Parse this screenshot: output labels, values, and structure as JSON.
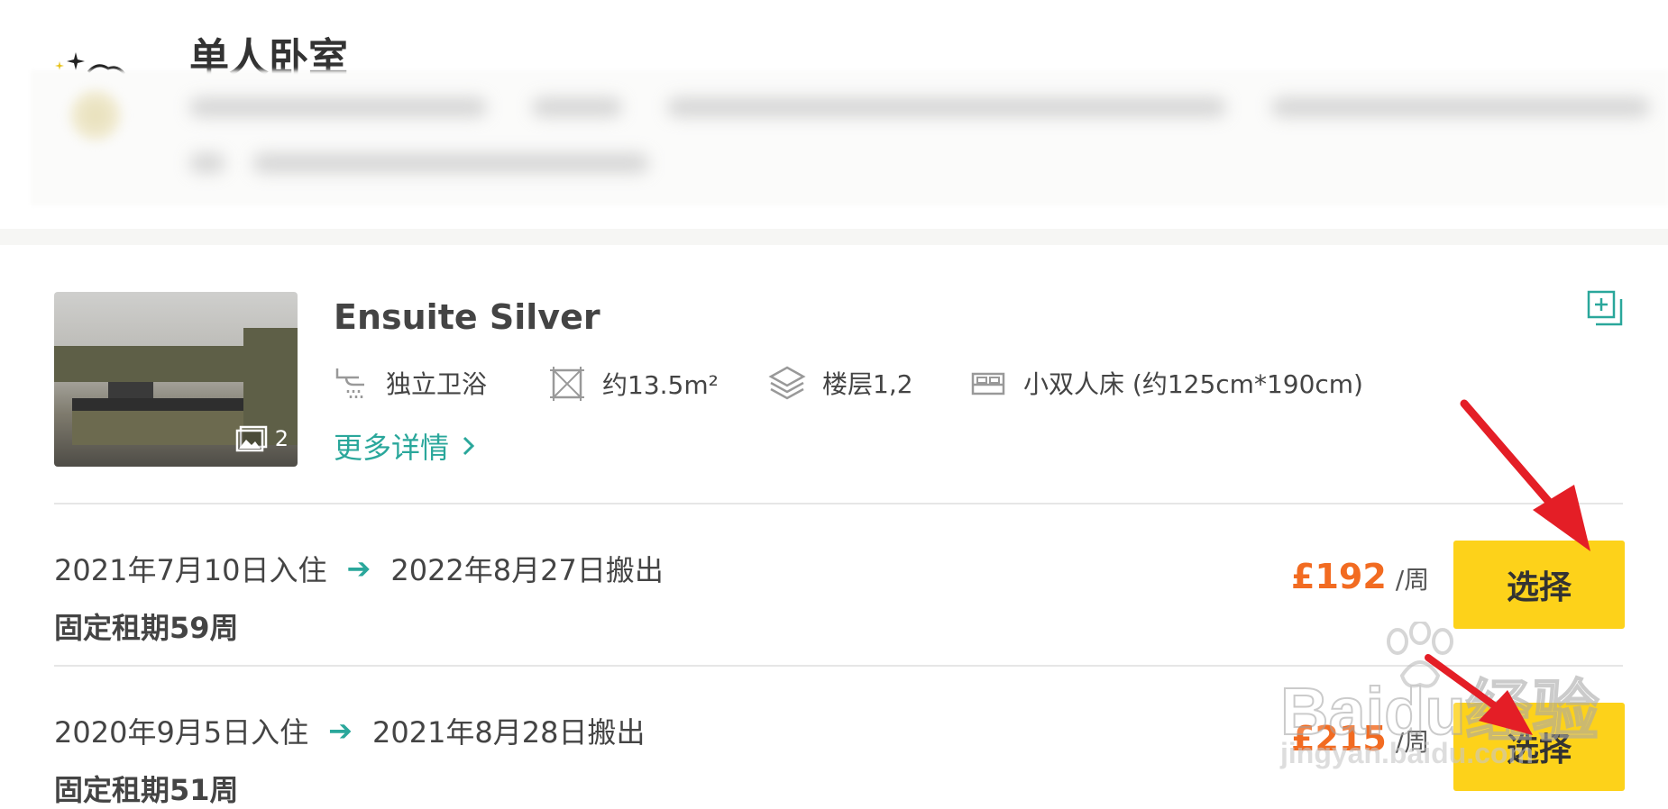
{
  "header": {
    "title": "单人卧室"
  },
  "room": {
    "name": "Ensuite Silver",
    "photo_count": "2",
    "amenities": [
      {
        "icon": "shower-icon",
        "label": "独立卫浴"
      },
      {
        "icon": "area-icon",
        "label": "约13.5m²"
      },
      {
        "icon": "layers-icon",
        "label": "楼层1,2"
      },
      {
        "icon": "bed-icon",
        "label": "小双人床 (约125cm*190cm)"
      }
    ],
    "more_details": "更多详情"
  },
  "offers": [
    {
      "check_in": "2021年7月10日入住",
      "check_out": "2022年8月27日搬出",
      "term": "固定租期59周",
      "price": "£192",
      "unit": "/周",
      "button": "选择"
    },
    {
      "check_in": "2020年9月5日入住",
      "check_out": "2021年8月28日搬出",
      "term": "固定租期51周",
      "price": "£215",
      "unit": "/周",
      "button": "选择"
    }
  ],
  "watermark": {
    "brand": "Baidu经验",
    "url": "jingyan.baidu.com"
  },
  "colors": {
    "accent_teal": "#2aa79b",
    "price_orange": "#f26b21",
    "button_yellow": "#fdd21a",
    "annotation_red": "#e41e26"
  }
}
